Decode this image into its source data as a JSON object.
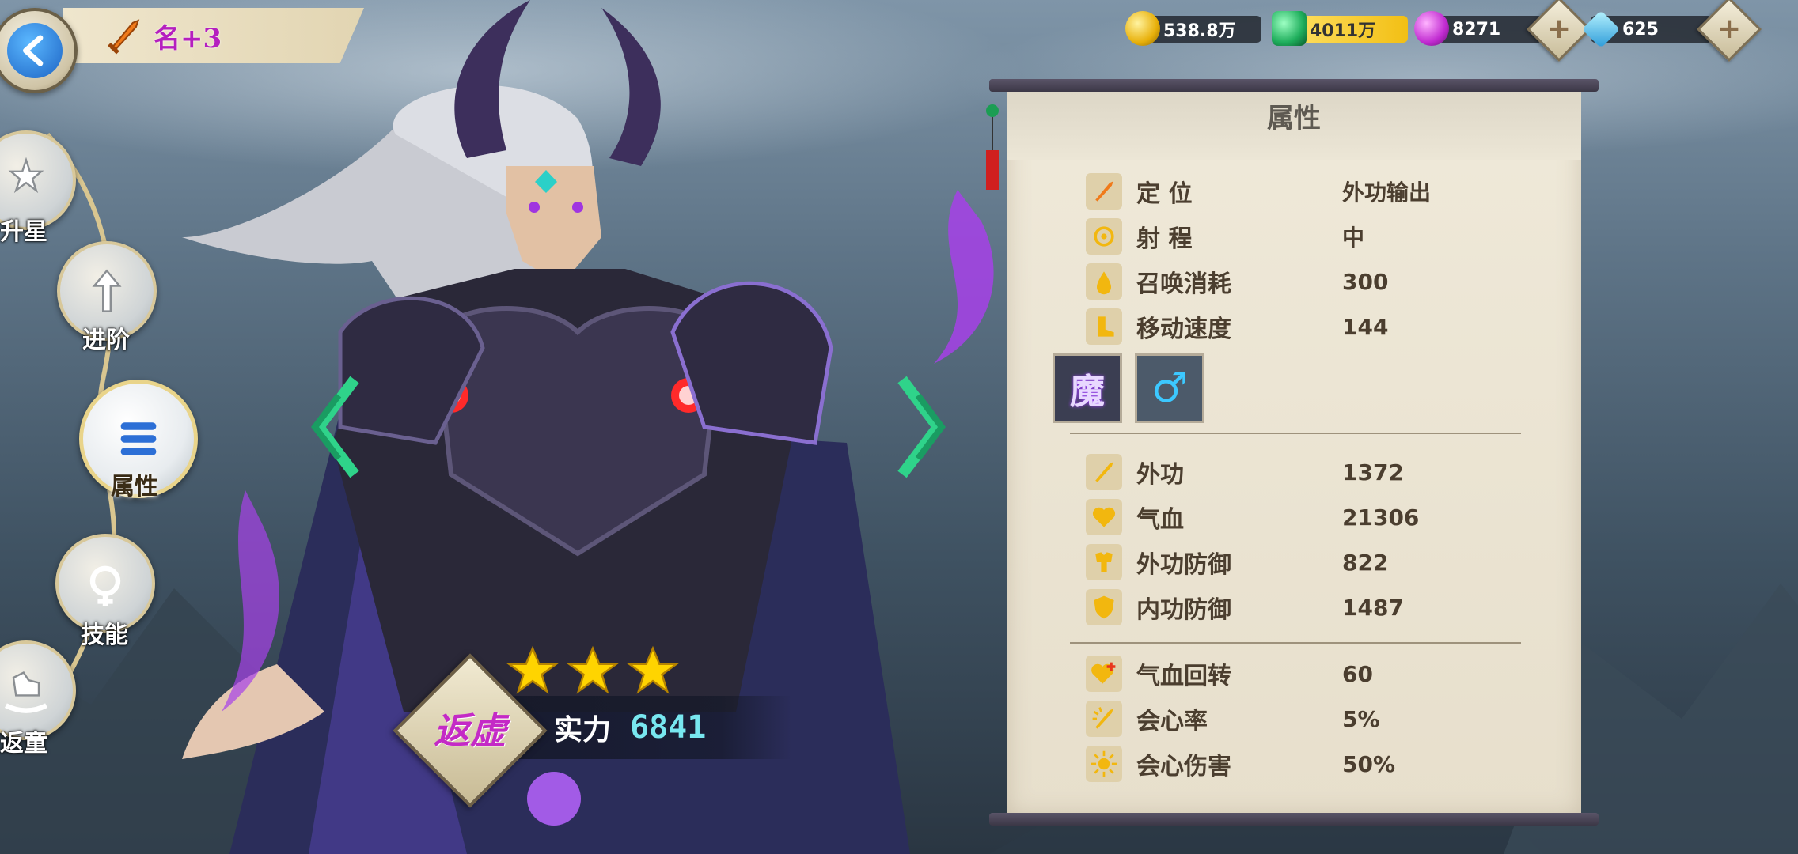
{
  "header": {
    "hero_name": "名+3"
  },
  "currency": {
    "gold": "538.8万",
    "jade": "4011万",
    "spirit": "8271",
    "diamond": "625"
  },
  "nav": [
    {
      "label": "升星",
      "icon": "stars-icon"
    },
    {
      "label": "进阶",
      "icon": "advance-arrow-icon"
    },
    {
      "label": "属性",
      "icon": "attributes-icon",
      "active": true
    },
    {
      "label": "技能",
      "icon": "skill-icon"
    },
    {
      "label": "返童",
      "icon": "rocking-horse-icon"
    }
  ],
  "hero": {
    "stars": 3,
    "rank": "返虚",
    "power_label": "实力",
    "power_value": "6841"
  },
  "panel": {
    "title": "属性",
    "basic": [
      {
        "name": "定 位",
        "value": "外功输出",
        "icon": "sword-icon"
      },
      {
        "name": "射 程",
        "value": "中",
        "icon": "target-icon"
      },
      {
        "name": "召唤消耗",
        "value": "300",
        "icon": "drop-icon"
      },
      {
        "name": "移动速度",
        "value": "144",
        "icon": "boot-icon"
      }
    ],
    "tags": {
      "faction": "魔",
      "gender": "♂"
    },
    "stats": [
      {
        "name": "外功",
        "value": "1372",
        "icon": "sword-icon"
      },
      {
        "name": "气血",
        "value": "21306",
        "icon": "heart-icon"
      },
      {
        "name": "外功防御",
        "value": "822",
        "icon": "armor-icon"
      },
      {
        "name": "内功防御",
        "value": "1487",
        "icon": "shield-icon"
      }
    ],
    "extra": [
      {
        "name": "气血回转",
        "value": "60",
        "icon": "heart-plus-icon"
      },
      {
        "name": "会心率",
        "value": "5%",
        "icon": "crit-icon"
      },
      {
        "name": "会心伤害",
        "value": "50%",
        "icon": "sun-icon"
      }
    ]
  },
  "colors": {
    "accent": "#b51fbf",
    "power": "#78e7f0",
    "panel_text": "#4b3e2f"
  }
}
